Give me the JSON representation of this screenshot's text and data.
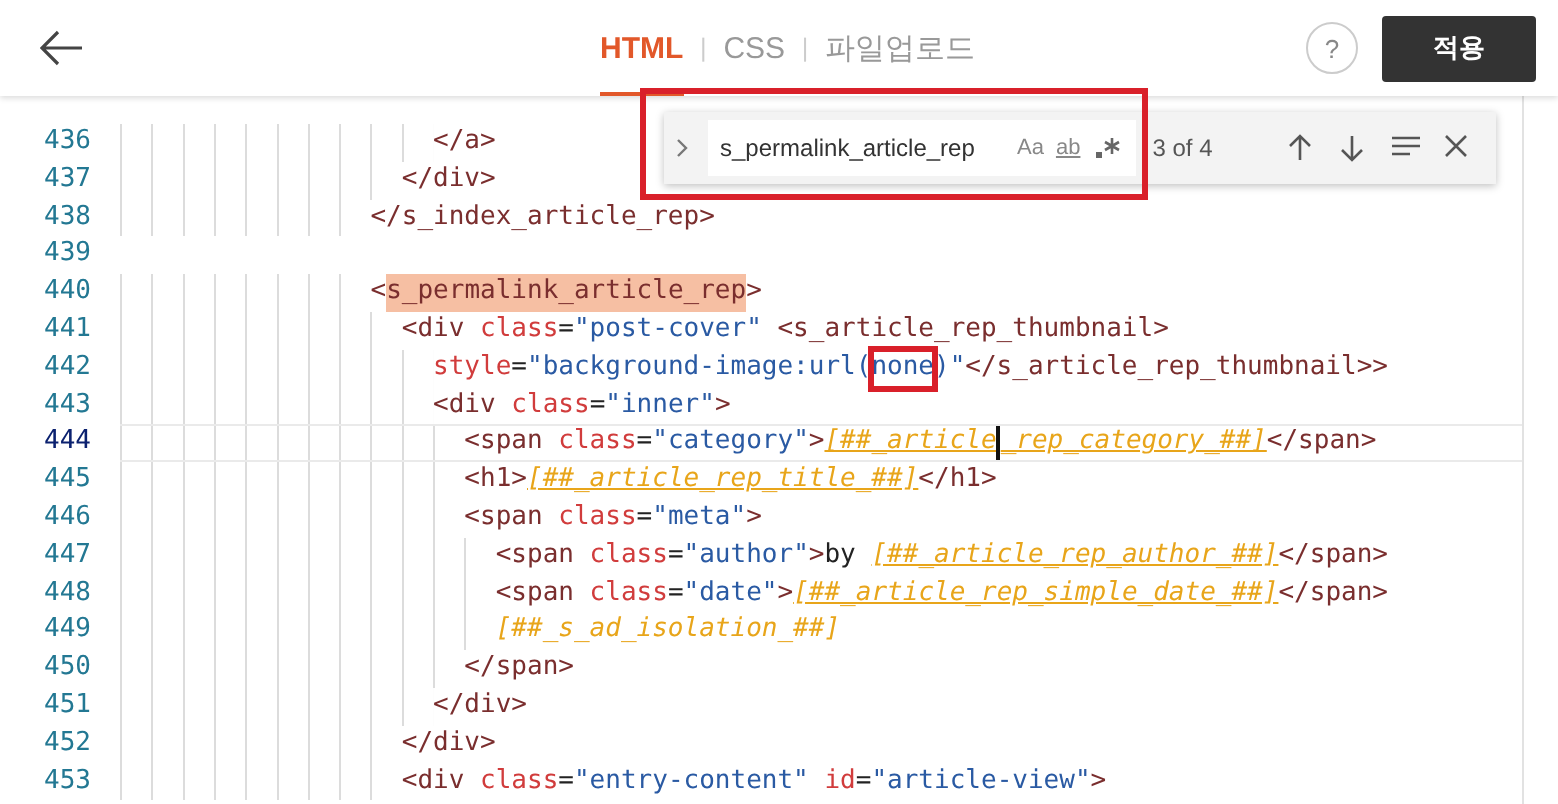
{
  "header": {
    "tabs": [
      {
        "label": "HTML",
        "selected": true
      },
      {
        "label": "CSS",
        "selected": false
      },
      {
        "label": "파일업로드",
        "selected": false
      }
    ],
    "separator": "|",
    "help": "?",
    "apply_button": "적용"
  },
  "editor": {
    "lines": [
      {
        "number": "436",
        "current": false,
        "tokens": [
          {
            "kind": "tag",
            "text": "                    </a>"
          }
        ]
      },
      {
        "number": "437",
        "current": false,
        "tokens": [
          {
            "kind": "tag",
            "text": "                  </div>"
          }
        ]
      },
      {
        "number": "438",
        "current": false,
        "tokens": [
          {
            "kind": "tag",
            "text": "                </s_index_article_rep>"
          }
        ]
      },
      {
        "number": "439",
        "current": false
      },
      {
        "number": "440",
        "current": false,
        "tokens": [
          {
            "kind": "tag",
            "text": "                <"
          },
          {
            "kind": "match",
            "text": "s_permalink_article_rep"
          },
          {
            "kind": "tag",
            "text": ">"
          }
        ]
      },
      {
        "number": "441",
        "current": false,
        "tokens": [
          {
            "kind": "tag",
            "text": "                  <div"
          },
          {
            "kind": "attr",
            "text": " class"
          },
          {
            "kind": "text",
            "text": "="
          },
          {
            "kind": "str",
            "text": "\"post-cover\""
          },
          {
            "kind": "tag",
            "text": " <s_article_rep_thumbnail>"
          }
        ]
      },
      {
        "number": "442",
        "current": false,
        "tokens": [
          {
            "kind": "attr",
            "text": "                    style"
          },
          {
            "kind": "text",
            "text": "="
          },
          {
            "kind": "str",
            "text": "\"background-image:url("
          },
          {
            "kind": "boxed",
            "text": "none"
          },
          {
            "kind": "str",
            "text": ")\""
          },
          {
            "kind": "tag",
            "text": "</s_article_rep_thumbnail>>"
          }
        ]
      },
      {
        "number": "443",
        "current": false,
        "tokens": [
          {
            "kind": "tag",
            "text": "                    <div"
          },
          {
            "kind": "attr",
            "text": " class"
          },
          {
            "kind": "text",
            "text": "="
          },
          {
            "kind": "str",
            "text": "\"inner\""
          },
          {
            "kind": "tag",
            "text": ">"
          }
        ]
      },
      {
        "number": "444",
        "current": true,
        "tokens": [
          {
            "kind": "tag",
            "text": "                      <span"
          },
          {
            "kind": "attr",
            "text": " class"
          },
          {
            "kind": "text",
            "text": "="
          },
          {
            "kind": "str",
            "text": "\"category\""
          },
          {
            "kind": "tag",
            "text": ">"
          },
          {
            "kind": "tpl",
            "text": "[##_article"
          },
          {
            "kind": "cursor"
          },
          {
            "kind": "tpl",
            "text": "_rep_category_##]"
          },
          {
            "kind": "tag",
            "text": "</span>"
          }
        ]
      },
      {
        "number": "445",
        "current": false,
        "tokens": [
          {
            "kind": "tag",
            "text": "                      <h1>"
          },
          {
            "kind": "tpl",
            "text": "[##_article_rep_title_##]"
          },
          {
            "kind": "tag",
            "text": "</h1>"
          }
        ]
      },
      {
        "number": "446",
        "current": false,
        "tokens": [
          {
            "kind": "tag",
            "text": "                      <span"
          },
          {
            "kind": "attr",
            "text": " class"
          },
          {
            "kind": "text",
            "text": "="
          },
          {
            "kind": "str",
            "text": "\"meta\""
          },
          {
            "kind": "tag",
            "text": ">"
          }
        ]
      },
      {
        "number": "447",
        "current": false,
        "tokens": [
          {
            "kind": "tag",
            "text": "                        <span"
          },
          {
            "kind": "attr",
            "text": " class"
          },
          {
            "kind": "text",
            "text": "="
          },
          {
            "kind": "str",
            "text": "\"author\""
          },
          {
            "kind": "tag",
            "text": ">"
          },
          {
            "kind": "text",
            "text": "by "
          },
          {
            "kind": "tpl",
            "text": "[##_article_rep_author_##]"
          },
          {
            "kind": "tag",
            "text": "</span>"
          }
        ]
      },
      {
        "number": "448",
        "current": false,
        "tokens": [
          {
            "kind": "tag",
            "text": "                        <span"
          },
          {
            "kind": "attr",
            "text": " class"
          },
          {
            "kind": "text",
            "text": "="
          },
          {
            "kind": "str",
            "text": "\"date\""
          },
          {
            "kind": "tag",
            "text": ">"
          },
          {
            "kind": "tpl",
            "text": "[##_article_rep_simple_date_##]"
          },
          {
            "kind": "tag",
            "text": "</span>"
          }
        ]
      },
      {
        "number": "449",
        "current": false,
        "tokens": [
          {
            "kind": "tpl",
            "text": "                        [##_s_ad_isolation_##]"
          }
        ]
      },
      {
        "number": "450",
        "current": false,
        "tokens": [
          {
            "kind": "tag",
            "text": "                      </span>"
          }
        ]
      },
      {
        "number": "451",
        "current": false,
        "tokens": [
          {
            "kind": "tag",
            "text": "                    </div>"
          }
        ]
      },
      {
        "number": "452",
        "current": false,
        "tokens": [
          {
            "kind": "tag",
            "text": "                  </div>"
          }
        ]
      },
      {
        "number": "453",
        "current": false,
        "tokens": [
          {
            "kind": "tag",
            "text": "                  <div"
          },
          {
            "kind": "attr",
            "text": " class"
          },
          {
            "kind": "text",
            "text": "="
          },
          {
            "kind": "str",
            "text": "\"entry-content\""
          },
          {
            "kind": "attr",
            "text": " id"
          },
          {
            "kind": "text",
            "text": "="
          },
          {
            "kind": "str",
            "text": "\"article-view\""
          },
          {
            "kind": "tag",
            "text": ">"
          }
        ]
      }
    ]
  },
  "find_widget": {
    "query": "s_permalink_article_rep",
    "match_case": "Aa",
    "whole_word": "ab",
    "count": "3 of 4",
    "annotated": true
  }
}
